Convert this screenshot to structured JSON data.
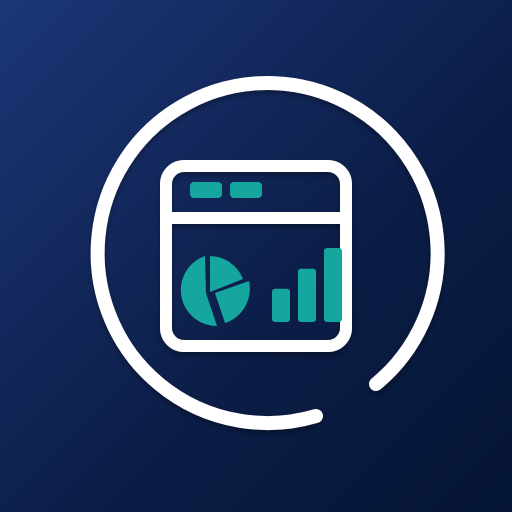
{
  "icon": {
    "name": "analytics-dashboard-app-icon",
    "background_gradient": [
      "#1c3677",
      "#0b1d46",
      "#061535"
    ],
    "ring_color": "#ffffff",
    "window_stroke_color": "#ffffff",
    "accent_color": "#15a79f",
    "glyphs": [
      "orbit-ring-icon",
      "browser-window-icon",
      "pie-chart-icon",
      "bar-chart-icon"
    ],
    "bar_chart_levels": [
      0.45,
      0.72,
      1.0
    ],
    "pie_slices": 3
  }
}
